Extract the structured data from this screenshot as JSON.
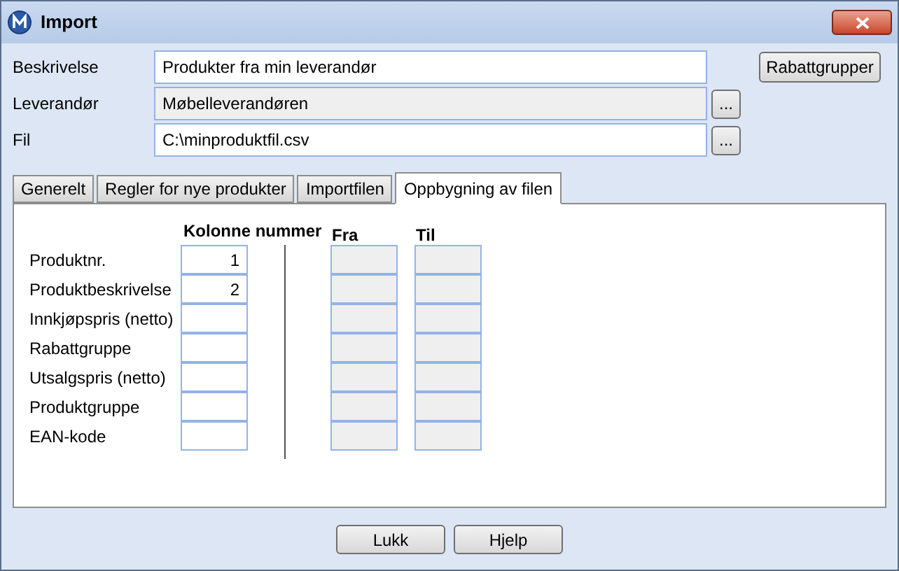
{
  "window": {
    "title": "Import"
  },
  "fields": [
    {
      "label": "Beskrivelse",
      "value": "Produkter fra min leverandør",
      "readonly": false
    },
    {
      "label": "Leverandør",
      "value": "Møbelleverandøren",
      "readonly": true,
      "browse_button": "..."
    },
    {
      "label": "Fil",
      "value": "C:\\minproduktfil.csv",
      "readonly": false,
      "browse_button": "..."
    }
  ],
  "side_button": "Rabattgrupper",
  "tabs": [
    {
      "label": "Generelt",
      "selected": false
    },
    {
      "label": "Regler for nye produkter",
      "selected": false
    },
    {
      "label": "Importfilen",
      "selected": false
    },
    {
      "label": "Oppbygning av filen",
      "selected": true
    }
  ],
  "table": {
    "columns": [
      "Kolonne nummer",
      "Fra",
      "Til"
    ],
    "rows": [
      {
        "label": "Produktnr.",
        "column": "1"
      },
      {
        "label": "Produktbeskrivelse",
        "column": "2"
      },
      {
        "label": "Innkjøpspris (netto)"
      },
      {
        "label": "Rabattgruppe"
      },
      {
        "label": "Utsalgspris (netto)"
      },
      {
        "label": "Produktgruppe"
      },
      {
        "label": "EAN-kode"
      }
    ]
  },
  "buttons": [
    "Lukk",
    "Hjelp"
  ]
}
